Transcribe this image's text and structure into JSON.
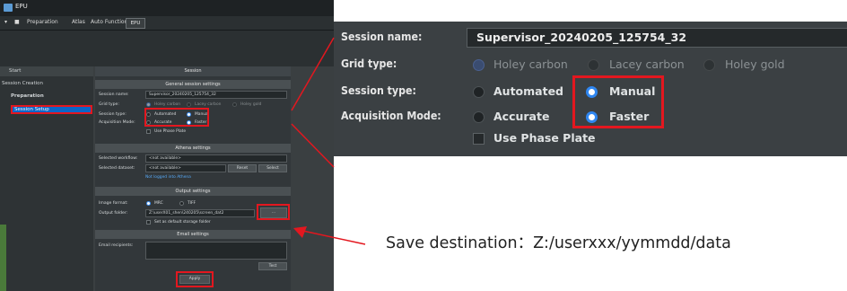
{
  "app": {
    "title": "EPU",
    "menu": [
      "Preparation",
      "Atlas",
      "Auto Functions"
    ],
    "active_tab": "EPU"
  },
  "left_nav": {
    "start": "Start",
    "session_creation": "Session Creation",
    "preparation": "Preparation",
    "session_setup": "Session Setup"
  },
  "session_panel": {
    "header": "Session",
    "general_header": "General session settings",
    "session_name_label": "Session name:",
    "session_name_value": "Supervisor_20240205_125754_32",
    "grid_type_label": "Grid type:",
    "grid_options": [
      "Holey carbon",
      "Lacey carbon",
      "Holey gold"
    ],
    "session_type_label": "Session type:",
    "session_type_options": [
      "Automated",
      "Manual"
    ],
    "acq_mode_label": "Acquisition Mode:",
    "acq_mode_options": [
      "Accurate",
      "Faster"
    ],
    "phase_plate": "Use Phase Plate",
    "athena_header": "Athena settings",
    "selected_workflow_label": "Selected workflow:",
    "selected_workflow_value": "<not available>",
    "selected_dataset_label": "Selected dataset:",
    "selected_dataset_value": "<not available>",
    "reset": "Reset",
    "select": "Select",
    "athena_link": "Not logged into Athena",
    "output_header": "Output settings",
    "image_format_label": "Image format:",
    "image_formats": [
      "MRC",
      "TIFF"
    ],
    "output_folder_label": "Output folder:",
    "output_folder_value": "Z:\\userX01_shen\\240205\\screen_dat2",
    "browse": "...",
    "default_storage": "Set as default storage folder",
    "email_header": "Email settings",
    "email_label": "Email recipients:",
    "test": "Test",
    "apply": "Apply"
  },
  "zoom": {
    "session_name_label": "Session name:",
    "session_name_value": "Supervisor_20240205_125754_32",
    "grid_type_label": "Grid type:",
    "grid_options": [
      "Holey carbon",
      "Lacey carbon",
      "Holey gold"
    ],
    "session_type_label": "Session type:",
    "session_type_options": [
      "Automated",
      "Manual"
    ],
    "acq_mode_label": "Acquisition Mode:",
    "acq_mode_options": [
      "Accurate",
      "Faster"
    ],
    "phase_plate": "Use Phase Plate"
  },
  "caption": "Save destination：Z:/userxxx/yymmdd/data",
  "colors": {
    "highlight": "#e3171f",
    "accent": "#2f86f0",
    "panel": "#3b4043"
  }
}
